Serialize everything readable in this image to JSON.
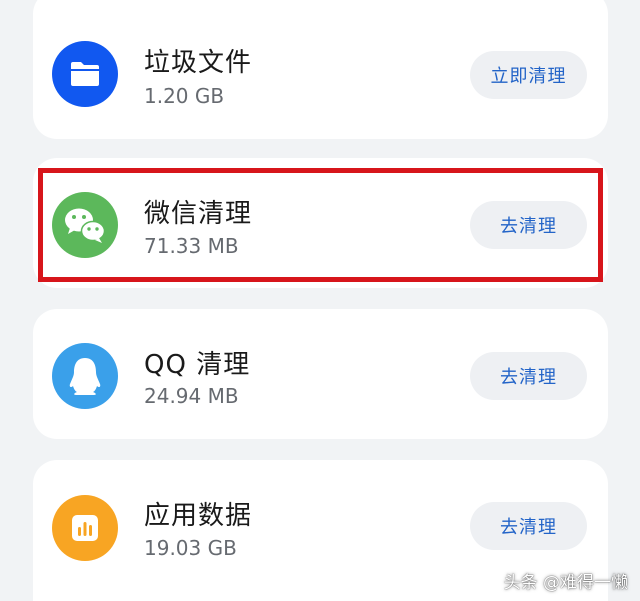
{
  "colors": {
    "background": "#f1f3f5",
    "card": "#ffffff",
    "button_bg": "#eef0f3",
    "button_text": "#2364c8",
    "highlight_border": "#d7151b",
    "junk_icon": "#1158f0",
    "wechat_icon": "#5cb85b",
    "qq_icon": "#3aa0ea",
    "app_data_icon": "#f8a523"
  },
  "items": [
    {
      "title": "垃圾文件",
      "size": "1.20 GB",
      "button": "立即清理",
      "icon": "folder-icon"
    },
    {
      "title": "微信清理",
      "size": "71.33 MB",
      "button": "去清理",
      "icon": "wechat-icon"
    },
    {
      "title": "QQ 清理",
      "size": "24.94 MB",
      "button": "去清理",
      "icon": "qq-penguin-icon"
    },
    {
      "title": "应用数据",
      "size": "19.03 GB",
      "button": "去清理",
      "icon": "bar-chart-icon"
    }
  ],
  "watermark": "头条 @难得一懒"
}
